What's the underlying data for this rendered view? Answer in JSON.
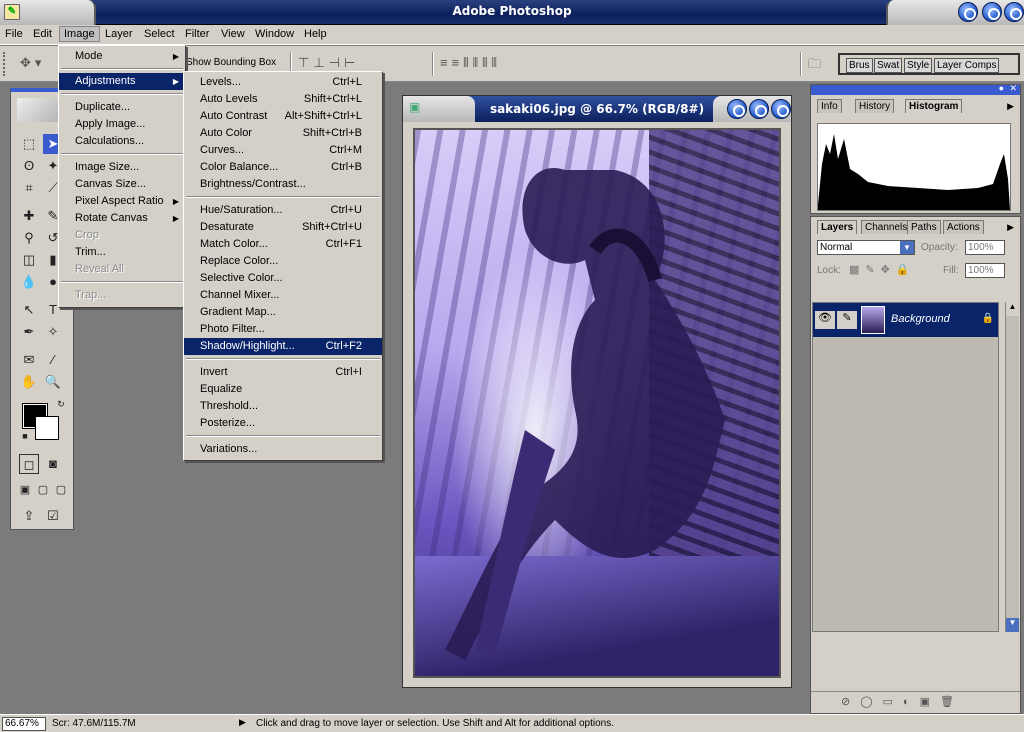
{
  "window": {
    "title": "Adobe Photoshop"
  },
  "menubar": {
    "items": [
      "File",
      "Edit",
      "Image",
      "Layer",
      "Select",
      "Filter",
      "View",
      "Window",
      "Help"
    ]
  },
  "options_bar": {
    "show_bounding_box": "Show Bounding Box"
  },
  "well_tabs": [
    "Brus",
    "Swat",
    "Style",
    "Layer Comps"
  ],
  "image_menu": {
    "items": [
      {
        "label": "Mode",
        "submenu": true
      },
      {
        "label": "Adjustments",
        "submenu": true,
        "highlighted": true
      },
      {
        "label": "Duplicate..."
      },
      {
        "label": "Apply Image..."
      },
      {
        "label": "Calculations..."
      },
      {
        "label": "Image Size..."
      },
      {
        "label": "Canvas Size..."
      },
      {
        "label": "Pixel Aspect Ratio",
        "submenu": true
      },
      {
        "label": "Rotate Canvas",
        "submenu": true
      },
      {
        "label": "Crop",
        "disabled": true
      },
      {
        "label": "Trim..."
      },
      {
        "label": "Reveal All",
        "disabled": true
      },
      {
        "label": "Trap...",
        "disabled": true
      }
    ]
  },
  "adjustments_menu": {
    "items": [
      {
        "label": "Levels...",
        "shortcut": "Ctrl+L"
      },
      {
        "label": "Auto Levels",
        "shortcut": "Shift+Ctrl+L"
      },
      {
        "label": "Auto Contrast",
        "shortcut": "Alt+Shift+Ctrl+L"
      },
      {
        "label": "Auto Color",
        "shortcut": "Shift+Ctrl+B"
      },
      {
        "label": "Curves...",
        "shortcut": "Ctrl+M"
      },
      {
        "label": "Color Balance...",
        "shortcut": "Ctrl+B"
      },
      {
        "label": "Brightness/Contrast...",
        "shortcut": ""
      },
      {
        "label": "Hue/Saturation...",
        "shortcut": "Ctrl+U"
      },
      {
        "label": "Desaturate",
        "shortcut": "Shift+Ctrl+U"
      },
      {
        "label": "Match Color...",
        "shortcut": "Ctrl+F1"
      },
      {
        "label": "Replace Color...",
        "shortcut": ""
      },
      {
        "label": "Selective Color...",
        "shortcut": ""
      },
      {
        "label": "Channel Mixer...",
        "shortcut": ""
      },
      {
        "label": "Gradient Map...",
        "shortcut": ""
      },
      {
        "label": "Photo Filter...",
        "shortcut": ""
      },
      {
        "label": "Shadow/Highlight...",
        "shortcut": "Ctrl+F2",
        "highlighted": true
      },
      {
        "label": "Invert",
        "shortcut": "Ctrl+I"
      },
      {
        "label": "Equalize",
        "shortcut": ""
      },
      {
        "label": "Threshold...",
        "shortcut": ""
      },
      {
        "label": "Posterize...",
        "shortcut": ""
      },
      {
        "label": "Variations...",
        "shortcut": ""
      }
    ]
  },
  "document": {
    "title": "sakaki06.jpg @ 66.7% (RGB/8#)"
  },
  "info_palette": {
    "tabs": [
      "Info",
      "History",
      "Histogram"
    ],
    "active_tab": "Histogram"
  },
  "layers_palette": {
    "tabs": [
      "Layers",
      "Channels",
      "Paths",
      "Actions"
    ],
    "active_tab": "Layers",
    "blend_mode": "Normal",
    "opacity_label": "Opacity:",
    "opacity_value": "100%",
    "lock_label": "Lock:",
    "fill_label": "Fill:",
    "fill_value": "100%",
    "layers": [
      {
        "name": "Background",
        "locked": true,
        "visible": true
      }
    ]
  },
  "statusbar": {
    "zoom": "66.67%",
    "scratch": "Scr: 47.6M/115.7M",
    "message": "Click and drag to move layer or selection.  Use Shift and Alt for additional options."
  }
}
